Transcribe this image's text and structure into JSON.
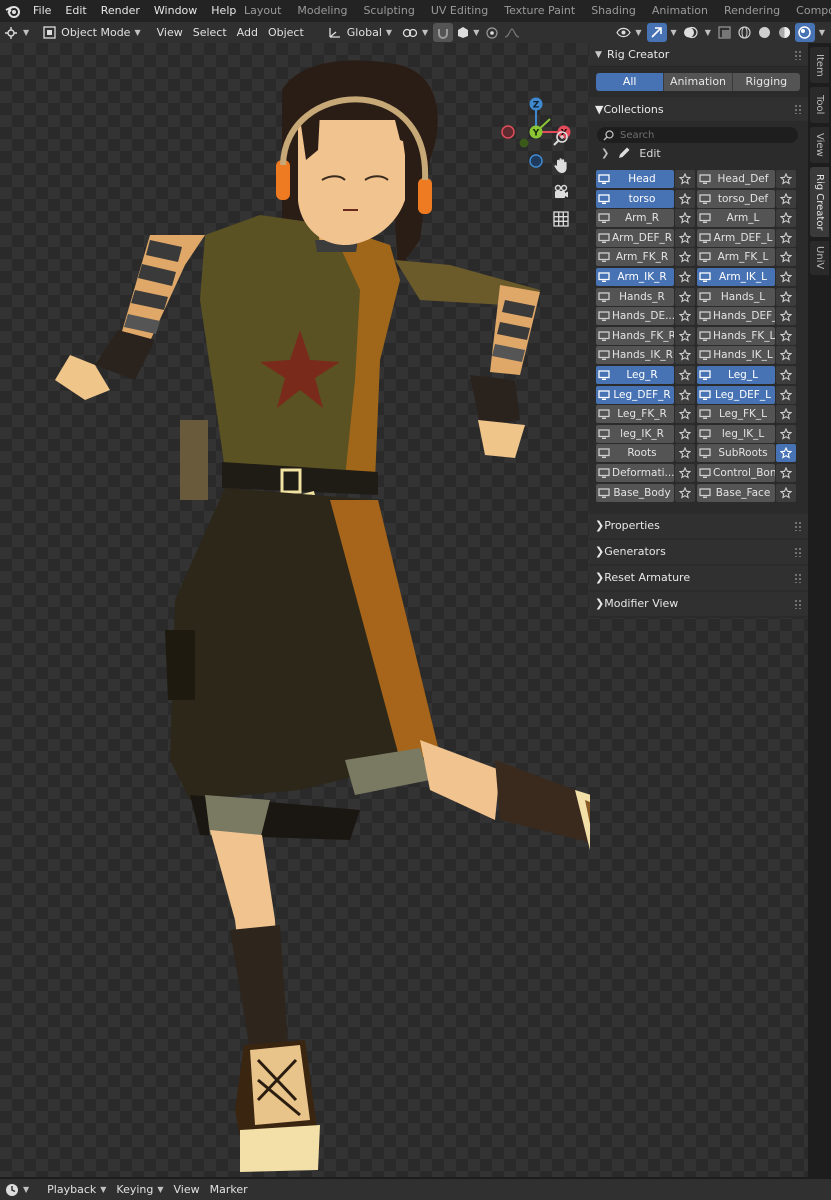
{
  "menubar": {
    "items": [
      "File",
      "Edit",
      "Render",
      "Window",
      "Help"
    ],
    "workspaces": [
      "Layout",
      "Modeling",
      "Sculpting",
      "UV Editing",
      "Texture Paint",
      "Shading",
      "Animation",
      "Rendering",
      "Compositing"
    ]
  },
  "viewport_header": {
    "mode": "Object Mode",
    "menus": [
      "View",
      "Select",
      "Add",
      "Object"
    ],
    "transform_orientation": "Global"
  },
  "gizmo": {
    "x": "X",
    "y": "Y",
    "z": "Z"
  },
  "npanel": {
    "title": "Rig Creator",
    "tabs": [
      "All",
      "Animation",
      "Rigging"
    ],
    "active_tab": "All",
    "collections_title": "Collections",
    "search_placeholder": "Search",
    "edit_label": "Edit",
    "collections": [
      {
        "left": "Head",
        "left_sel": true,
        "right": "Head_Def",
        "right_sel": false,
        "star_sel": false
      },
      {
        "left": "torso",
        "left_sel": true,
        "right": "torso_Def",
        "right_sel": false,
        "star_sel": false
      },
      {
        "left": "Arm_R",
        "left_sel": false,
        "right": "Arm_L",
        "right_sel": false,
        "star_sel": false
      },
      {
        "left": "Arm_DEF_R",
        "left_sel": false,
        "right": "Arm_DEF_L",
        "right_sel": false,
        "star_sel": false
      },
      {
        "left": "Arm_FK_R",
        "left_sel": false,
        "right": "Arm_FK_L",
        "right_sel": false,
        "star_sel": false
      },
      {
        "left": "Arm_IK_R",
        "left_sel": true,
        "right": "Arm_IK_L",
        "right_sel": true,
        "star_sel": false
      },
      {
        "left": "Hands_R",
        "left_sel": false,
        "right": "Hands_L",
        "right_sel": false,
        "star_sel": false
      },
      {
        "left": "Hands_DE...",
        "left_sel": false,
        "right": "Hands_DEF_L",
        "right_sel": false,
        "star_sel": false
      },
      {
        "left": "Hands_FK_R",
        "left_sel": false,
        "right": "Hands_FK_L",
        "right_sel": false,
        "star_sel": false
      },
      {
        "left": "Hands_IK_R",
        "left_sel": false,
        "right": "Hands_IK_L",
        "right_sel": false,
        "star_sel": false
      },
      {
        "left": "Leg_R",
        "left_sel": true,
        "right": "Leg_L",
        "right_sel": true,
        "star_sel": false
      },
      {
        "left": "Leg_DEF_R",
        "left_sel": true,
        "right": "Leg_DEF_L",
        "right_sel": true,
        "star_sel": false
      },
      {
        "left": "Leg_FK_R",
        "left_sel": false,
        "right": "Leg_FK_L",
        "right_sel": false,
        "star_sel": false
      },
      {
        "left": "leg_IK_R",
        "left_sel": false,
        "right": "leg_IK_L",
        "right_sel": false,
        "star_sel": false
      },
      {
        "left": "Roots",
        "left_sel": false,
        "right": "SubRoots",
        "right_sel": false,
        "star_sel": true
      },
      {
        "left": "Deformati...",
        "left_sel": false,
        "right": "Control_Bone",
        "right_sel": false,
        "star_sel": false
      },
      {
        "left": "Base_Body",
        "left_sel": false,
        "right": "Base_Face",
        "right_sel": false,
        "star_sel": false
      }
    ],
    "subpanels": [
      "Properties",
      "Generators",
      "Reset Armature",
      "Modifier View"
    ]
  },
  "side_tabs": [
    "Item",
    "Tool",
    "View",
    "Rig Creator",
    "UniV"
  ],
  "active_side_tab": "Rig Creator",
  "bottombar": {
    "menus": [
      "Playback",
      "Keying",
      "View",
      "Marker"
    ]
  },
  "colors": {
    "accent": "#4772b3",
    "gizmo_x": "#e34b5a",
    "gizmo_y": "#8bc735",
    "gizmo_z": "#3f89d1"
  }
}
